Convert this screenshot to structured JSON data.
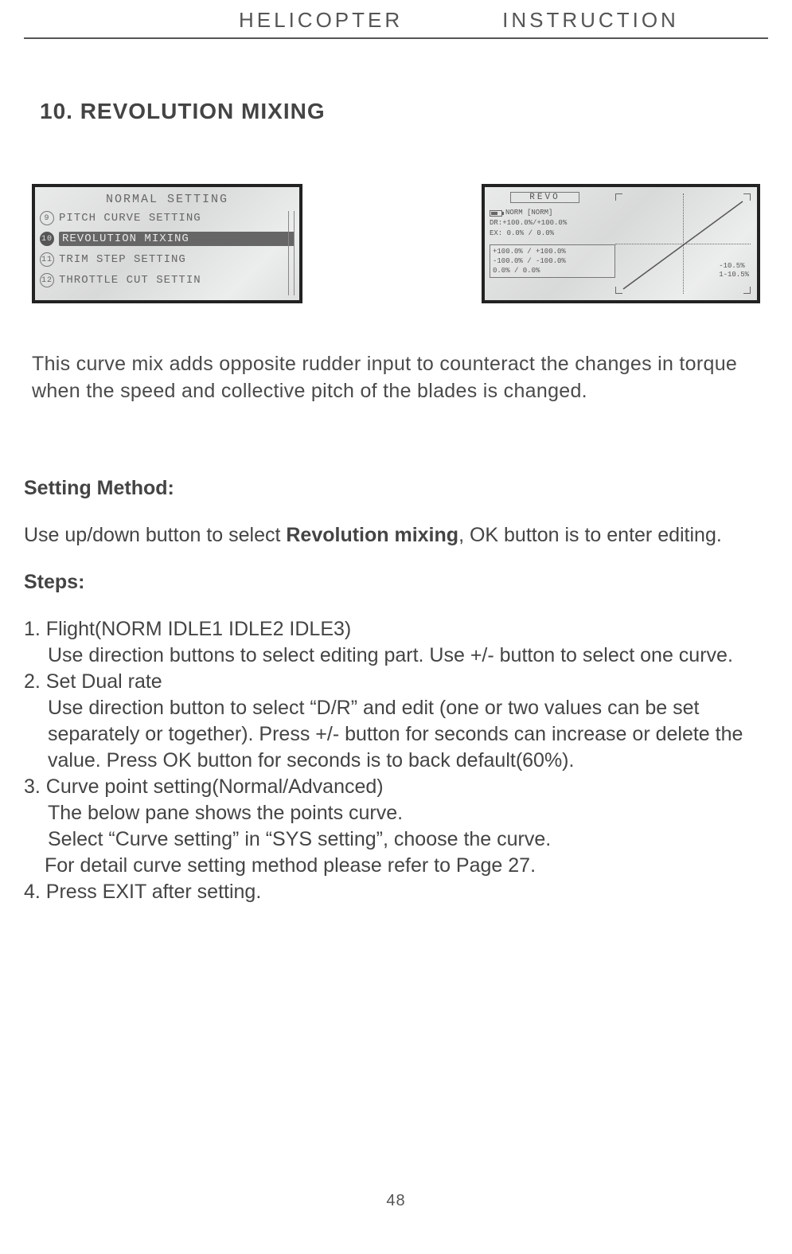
{
  "header": {
    "left": "HELICOPTER",
    "right": "INSTRUCTION"
  },
  "section_title": "10. REVOLUTION MIXING",
  "lcd_left": {
    "title": "NORMAL SETTING",
    "items": [
      {
        "num": "9",
        "label": "PITCH CURVE SETTING",
        "selected": false
      },
      {
        "num": "10",
        "label": "REVOLUTION MIXING",
        "selected": true
      },
      {
        "num": "11",
        "label": "TRIM STEP SETTING",
        "selected": false
      },
      {
        "num": "12",
        "label": "THROTTLE CUT SETTIN",
        "selected": false
      }
    ]
  },
  "lcd_right": {
    "title": "REVO",
    "line1": "NORM  [NORM]",
    "line2": "DR:+100.0%/+100.0%",
    "line3": "EX: 0.0%   / 0.0%",
    "box": [
      "+100.0% / +100.0%",
      "-100.0% / -100.0%",
      "0.0%    / 0.0%"
    ],
    "graph_labels": [
      "-10.5%",
      "1-10.5%"
    ]
  },
  "intro": "This curve mix adds opposite rudder input to counteract the changes in torque when the speed and collective pitch of the blades is changed.",
  "setting_method": {
    "title": "Setting Method:",
    "pre": "Use up/down button to select ",
    "bold": "Revolution mixing",
    "post": ", OK button is to enter editing."
  },
  "steps": {
    "title": "Steps:",
    "s1h": "1. Flight(NORM IDLE1 IDLE2 IDLE3)",
    "s1d": "Use direction buttons to select editing part. Use +/- button to select one curve.",
    "s2h": "2. Set Dual rate",
    "s2d": "Use direction button to select “D/R” and edit (one or two values can be set separately or together). Press +/- button for seconds can increase or delete the value. Press OK button for seconds is to back default(60%).",
    "s3h": "3. Curve point setting(Normal/Advanced)",
    "s3d1": "The below pane shows the points curve.",
    "s3d2": "Select “Curve setting” in “SYS setting”, choose the curve.",
    "s3d3": "For detail curve setting method please refer to Page 27.",
    "s4h": "4. Press EXIT after setting."
  },
  "page_number": "48"
}
